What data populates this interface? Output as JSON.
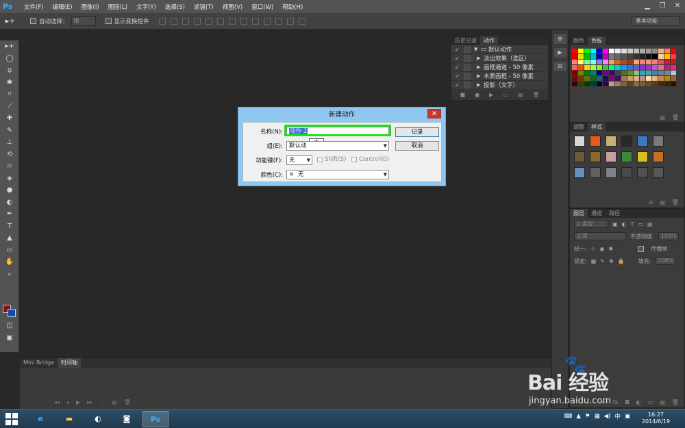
{
  "app": {
    "logo": "Ps"
  },
  "menu": [
    "文件(F)",
    "编辑(E)",
    "图像(I)",
    "图层(L)",
    "文字(Y)",
    "选择(S)",
    "滤镜(T)",
    "视图(V)",
    "窗口(W)",
    "帮助(H)"
  ],
  "options_bar": {
    "auto_select_label": "自动选择：",
    "auto_select_value": "组",
    "show_transform_label": "显示变换控件",
    "workspace": "基本功能"
  },
  "timeline": {
    "tabs": [
      "Mini Bridge",
      "时间轴"
    ]
  },
  "actions_panel": {
    "tabs": [
      "历史记录",
      "动作"
    ],
    "rows": [
      {
        "label": "默认动作",
        "is_set": true
      },
      {
        "label": "淡出效果（选区）"
      },
      {
        "label": "画框通道 - 50 像素"
      },
      {
        "label": "木质画框 - 50 像素"
      },
      {
        "label": "投影（文字）"
      }
    ]
  },
  "swatches_panel": {
    "tabs": [
      "颜色",
      "色板"
    ]
  },
  "styles_panel": {
    "tabs": [
      "调整",
      "样式"
    ]
  },
  "layers_panel": {
    "tabs": [
      "图层",
      "通道",
      "路径"
    ],
    "filter_kind": "ρ 类型",
    "blend_mode": "正常",
    "opacity_label": "不透明度:",
    "opacity_value": "100%",
    "unify_label": "统一:",
    "propagate_label": "传播帧",
    "lock_label": "锁定:",
    "fill_label": "填充:",
    "fill_value": "100%"
  },
  "dialog": {
    "title": "新建动作",
    "name_label": "名称(N):",
    "name_value": "动作 1",
    "set_label": "组(E):",
    "set_value": "默认动",
    "function_key_label": "功能键(F):",
    "function_key_value": "无",
    "shift_label": "Shift(S)",
    "control_label": "Control(O)",
    "color_label": "颜色(C):",
    "color_value": "无",
    "color_mark": "×",
    "record_button": "记录",
    "cancel_button": "取消",
    "ime_char": "中"
  },
  "taskbar": {
    "tray_ime": "中",
    "time": "16:27",
    "date": "2014/6/19"
  },
  "watermark": {
    "brand": "Bai 经验",
    "url": "jingyan.baidu.com"
  },
  "colors": {
    "accent_highlight": "#22dd22",
    "foreground": "#8b1010",
    "background": "#0d4fa8",
    "dialog_frame": "#8fc7f1"
  }
}
